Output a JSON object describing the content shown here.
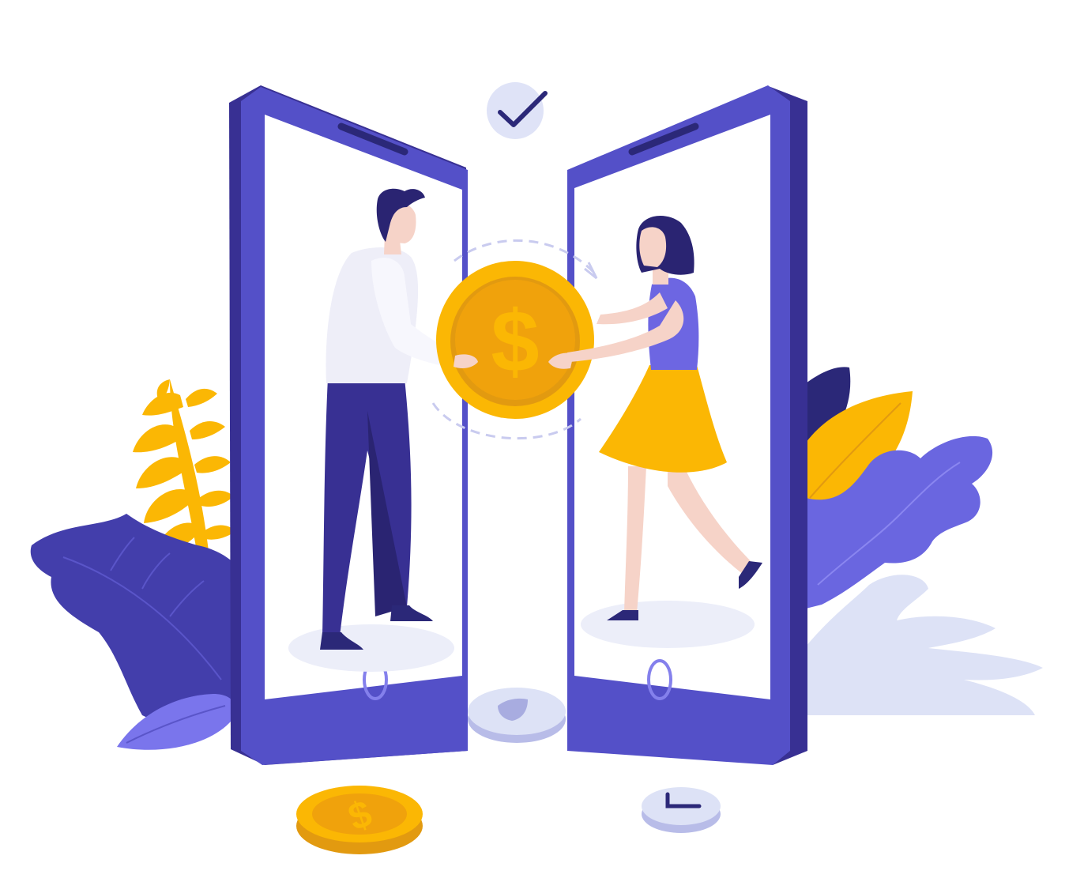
{
  "illustration": {
    "colors": {
      "phone_body": "#5450c8",
      "phone_side": "#383093",
      "screen": "#ffffff",
      "coin_gold": "#fbb704",
      "coin_dark": "#e29a10",
      "coin_inner": "#f0a20c",
      "leaf_purple": "#433eab",
      "leaf_violet": "#6a66e0",
      "leaf_light": "#dde2f6",
      "man_shirt": "#eeeef8",
      "man_pants": "#383093",
      "woman_top": "#6d66e2",
      "woman_skirt": "#fbb704",
      "skin": "#f6d3c8",
      "hair": "#2a2472"
    },
    "icons": [
      "check-icon",
      "dollar-coin-icon",
      "shield-icon",
      "clock-icon"
    ]
  }
}
